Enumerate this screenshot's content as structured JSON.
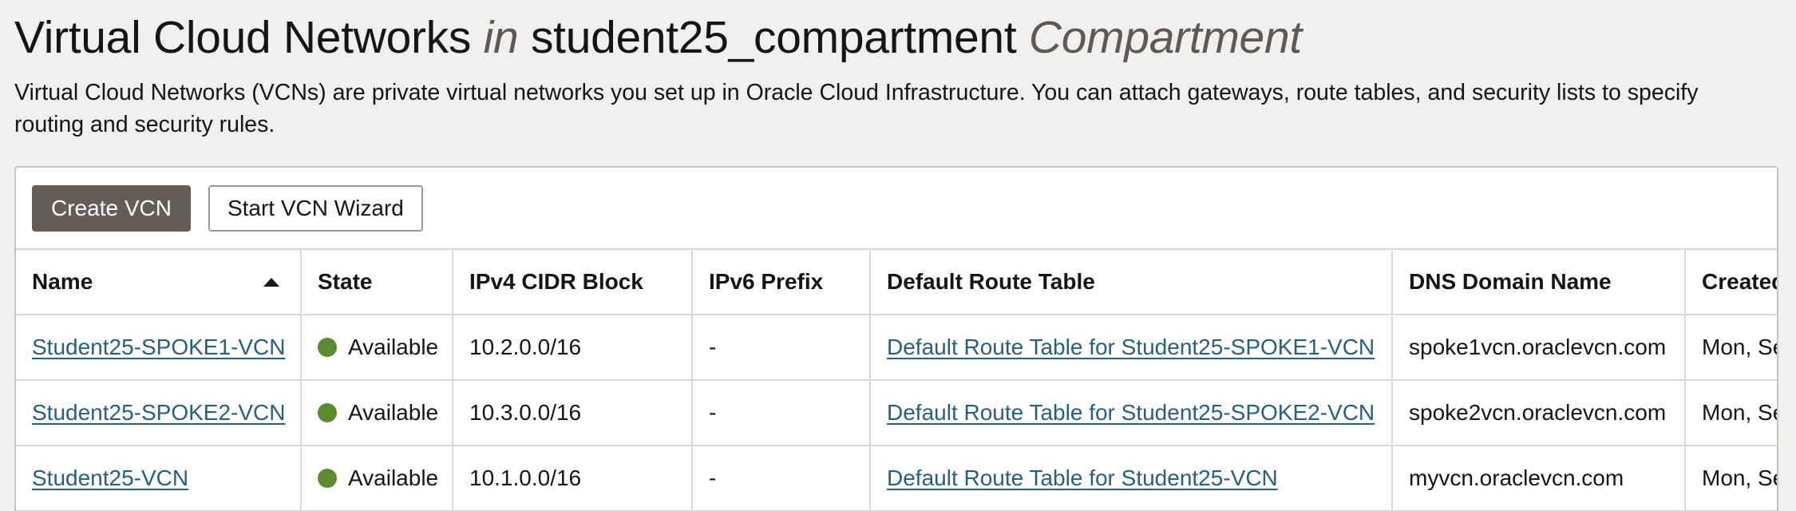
{
  "header": {
    "title_main": "Virtual Cloud Networks",
    "title_in": "in",
    "title_compartment": "student25_compartment",
    "title_suffix": "Compartment",
    "description": "Virtual Cloud Networks (VCNs) are private virtual networks you set up in Oracle Cloud Infrastructure. You can attach gateways, route tables, and security lists to specify routing and security rules."
  },
  "toolbar": {
    "create_label": "Create VCN",
    "wizard_label": "Start VCN Wizard"
  },
  "table": {
    "columns": [
      "Name",
      "State",
      "IPv4 CIDR Block",
      "IPv6 Prefix",
      "Default Route Table",
      "DNS Domain Name",
      "Created"
    ],
    "sort_icon": "sort-ascending-icon",
    "rows": [
      {
        "name": "Student25-SPOKE1-VCN",
        "state": "Available",
        "cidr": "10.2.0.0/16",
        "ipv6": "-",
        "route_table": "Default Route Table for Student25-SPOKE1-VCN",
        "dns": "spoke1vcn.oraclevcn.com",
        "created": "Mon, Se"
      },
      {
        "name": "Student25-SPOKE2-VCN",
        "state": "Available",
        "cidr": "10.3.0.0/16",
        "ipv6": "-",
        "route_table": "Default Route Table for Student25-SPOKE2-VCN",
        "dns": "spoke2vcn.oraclevcn.com",
        "created": "Mon, Se"
      },
      {
        "name": "Student25-VCN",
        "state": "Available",
        "cidr": "10.1.0.0/16",
        "ipv6": "-",
        "route_table": "Default Route Table for Student25-VCN",
        "dns": "myvcn.oraclevcn.com",
        "created": "Mon, Se"
      }
    ]
  },
  "colors": {
    "status_available": "#5b8b2c",
    "link": "#27607e",
    "primary_button": "#645d56"
  }
}
